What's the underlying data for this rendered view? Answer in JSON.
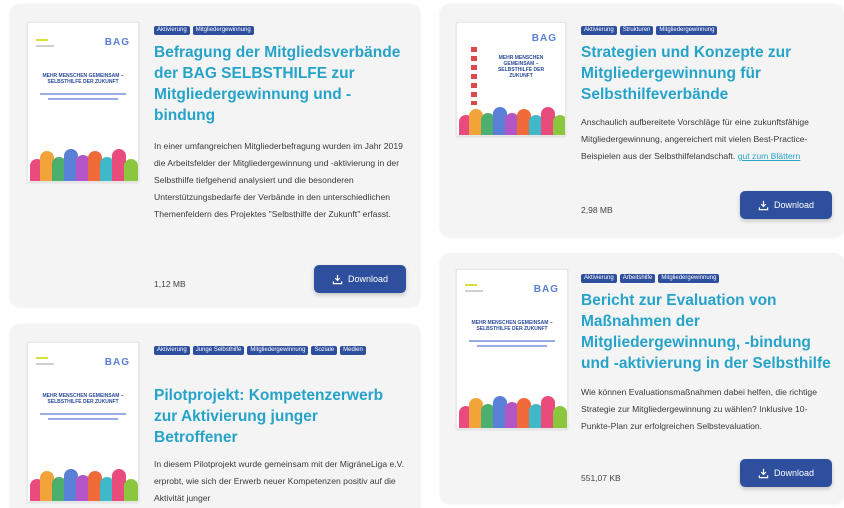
{
  "cards": [
    {
      "tags": [
        "Aktivierung",
        "Mitgliedergewinnung"
      ],
      "title": "Befragung der Mitgliedsverbände der BAG SELBSTHILFE zur Mitgliedergewinnung und -bindung",
      "description": "In einer umfangreichen Mitgliederbefragung wurden im Jahr 2019 die Arbeitsfelder der Mitgliedergewinnung und -aktivierung in der Selbsthilfe tiefgehend analysiert und die besonderen Unterstützungsbedarfe der Verbände in den unterschiedlichen Themenfeldern des Projektes \"Selbsthilfe der Zukunft\" erfasst.",
      "size": "1,12 MB",
      "button": "Download",
      "thumb_logo": "BAG",
      "thumb_title": "MEHR MENSCHEN GEMEINSAM – SELBSTHILFE DER ZUKUNFT"
    },
    {
      "tags": [
        "Aktivierung",
        "Strukturen",
        "Mitgliedergewinnung"
      ],
      "title": "Strategien und Konzepte zur Mitgliedergewinnung für Selbsthilfeverbände",
      "description": "Anschaulich aufbereitete Vorschläge für eine zukunftsfähige Mitgliedergewinnung, angereichert mit vielen Best-Practice-Beispielen aus der Selbsthilfelandschaft.",
      "link": "gut zum Blättern",
      "size": "2,98 MB",
      "button": "Download",
      "thumb_logo": "BAG",
      "thumb_title": "MEHR MENSCHEN GEMEINSAM – SELBSTHILFE DER ZUKUNFT"
    },
    {
      "tags": [
        "Aktivierung",
        "Arbeitshilfe",
        "Mitgliedergewinnung"
      ],
      "title": "Bericht zur Evaluation von Maßnahmen der Mitgliedergewinnung, -bindung und -aktivierung in der Selbsthilfe",
      "description": "Wie können Evaluationsmaßnahmen dabei helfen, die richtige Strategie zur Mitgliedergewinnung zu wählen? Inklusive 10-Punkte-Plan zur erfolgreichen Selbstevaluation.",
      "size": "551,07 KB",
      "button": "Download",
      "thumb_logo": "BAG",
      "thumb_title": "MEHR MENSCHEN GEMEINSAM – SELBSTHILFE DER ZUKUNFT"
    },
    {
      "tags": [
        "Aktivierung",
        "Junge Selbsthilfe",
        "Mitgliedergewinnung",
        "Soziale",
        "Medien"
      ],
      "title": "Pilotprojekt: Kompetenzerwerb zur Aktivierung junger Betroffener",
      "description": "In diesem Pilotprojekt wurde gemeinsam mit der MigräneLiga e.V. erprobt, wie sich der Erwerb neuer Kompetenzen positiv auf die Aktivität junger",
      "thumb_logo": "BAG",
      "thumb_title": "MEHR MENSCHEN GEMEINSAM – SELBSTHILFE DER ZUKUNFT"
    }
  ],
  "colors": {
    "accent": "#26a3c9",
    "button": "#2e4f9e",
    "card": "#f4f4f4"
  },
  "icons": {
    "download": "download-icon"
  }
}
